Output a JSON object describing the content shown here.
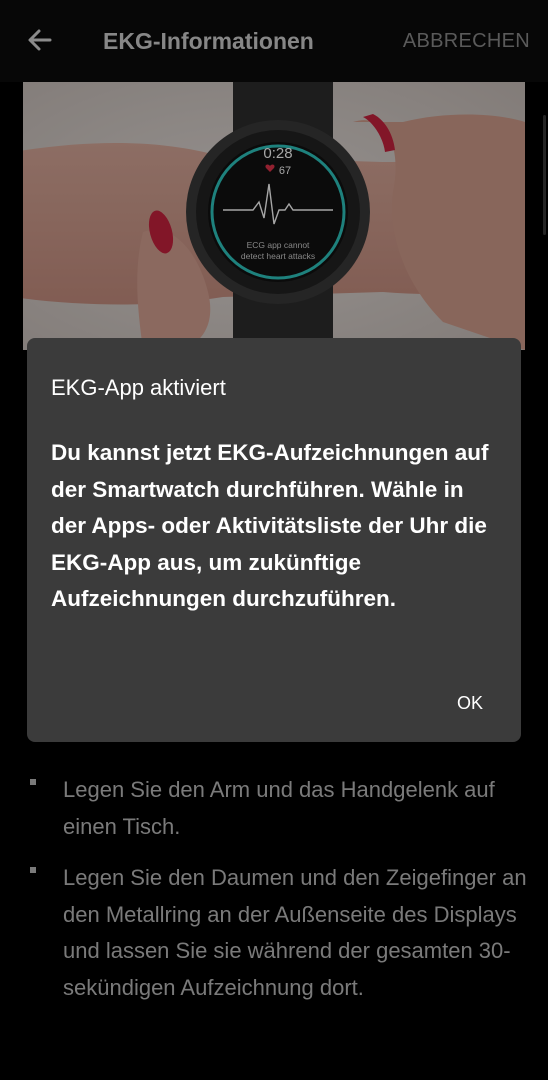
{
  "header": {
    "title": "EKG-Informationen",
    "cancel_label": "ABBRECHEN",
    "back_icon": "arrow-left-icon"
  },
  "hero": {
    "watch_time": "0:28",
    "watch_hr": "67",
    "watch_line1": "ECG app cannot",
    "watch_line2": "detect heart attacks"
  },
  "content": {
    "bullets": [
      "Legen Sie den Arm und das Handgelenk auf einen Tisch.",
      "Legen Sie den Daumen und den Zeigefinger an den Metallring an der Außenseite des Displays und lassen Sie sie während der gesamten 30-sekündigen Aufzeichnung dort."
    ]
  },
  "dialog": {
    "title": "EKG-App aktiviert",
    "body": "Du kannst jetzt EKG-Aufzeichnungen auf der Smartwatch durchführen. Wähle in der Apps- oder Aktivitätsliste der Uhr die EKG-App aus, um zukünftige Aufzeichnungen durchzuführen.",
    "ok_label": "OK"
  },
  "colors": {
    "background": "#000000",
    "dialog_bg": "#3b3b3b",
    "accent_watch": "#2fc6c0",
    "heart": "#e0344a"
  }
}
